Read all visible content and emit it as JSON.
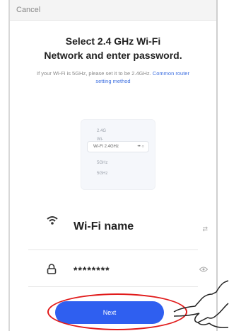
{
  "header": {
    "cancel_label": "Cancel"
  },
  "title": {
    "line1": "Select 2.4 GHz Wi-Fi",
    "line2": "Network and enter password."
  },
  "hint": {
    "text": "If your Wi-Fi is 5GHz, please set it to be 2.4GHz.",
    "link": "Common router setting method"
  },
  "illustration": {
    "rows": [
      {
        "label": "2.4G Wi-Fi"
      },
      {
        "label": "Wi-Fi 2.4GHz",
        "signal": "•• ○"
      },
      {
        "label": "5GHz"
      },
      {
        "label": "5GHz"
      }
    ]
  },
  "wifi": {
    "icon": "wifi-icon",
    "name": "Wi-Fi name",
    "switch_label": "⇄"
  },
  "password": {
    "icon": "lock-icon",
    "value": "********",
    "toggle_icon": "eye-icon"
  },
  "next_button": {
    "label": "Next"
  },
  "colors": {
    "accent": "#2f5ff0",
    "annotation": "#e11b1b"
  }
}
